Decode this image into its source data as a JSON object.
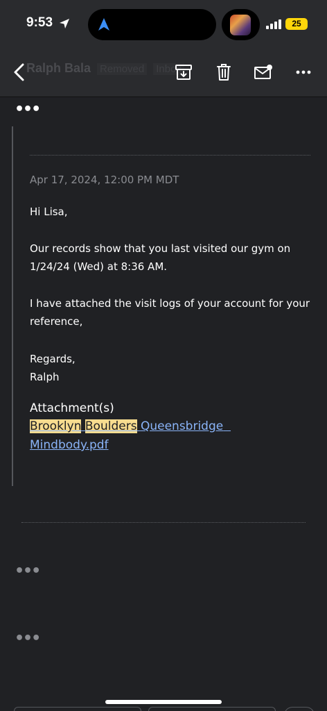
{
  "status_bar": {
    "time": "9:53",
    "battery": "25"
  },
  "toolbar": {
    "title_sender": "Ralph Bala",
    "title_badge_1": "Removed",
    "title_badge_2": "Inbox",
    "icons": [
      "chevron-left-icon",
      "archive-icon",
      "trash-icon",
      "mail-unread-icon",
      "more-horizontal-icon"
    ]
  },
  "thread": {
    "collapsed_top": "•••",
    "message": {
      "date": "Apr 17, 2024, 12:00 PM MDT",
      "greeting": "Hi Lisa,",
      "para1_line1": "Our records show that you last visited our gym on",
      "para1_line2": "1/24/24 (Wed) at 8:36 AM.",
      "para2_line1": "I have attached the visit logs of your account for your",
      "para2_line2": "reference,",
      "closing": "Regards,",
      "signature": "Ralph",
      "attachment_title": "Attachment(s)",
      "attachment_word1": "Brooklyn",
      "attachment_word2": "Boulders",
      "attachment_word3": "Queensbridge",
      "attachment_line2": "Mindbody.pdf"
    },
    "collapsed_mid": "•••",
    "collapsed_bottom": "•••"
  },
  "colors": {
    "background": "#202124",
    "link": "#8ab4f8",
    "highlight": "#f7dc8f",
    "battery": "#ffd60a"
  }
}
